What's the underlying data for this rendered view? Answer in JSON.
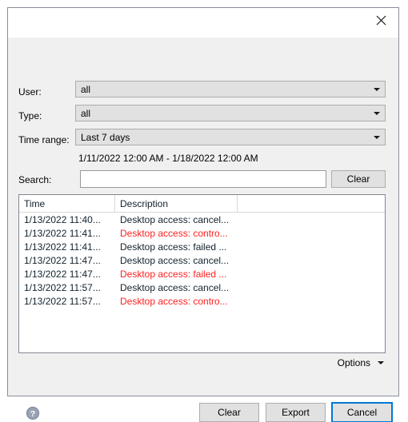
{
  "window": {
    "title": "",
    "close_icon": "close-icon"
  },
  "filters": {
    "user": {
      "label": "User:",
      "value": "all",
      "options": [
        "all"
      ]
    },
    "type": {
      "label": "Type:",
      "value": "all",
      "options": [
        "all"
      ]
    },
    "time_range": {
      "label": "Time range:",
      "value": "Last 7 days",
      "options": [
        "Last 7 days"
      ]
    },
    "date_range_text": "1/11/2022 12:00 AM - 1/18/2022 12:00 AM"
  },
  "search": {
    "label": "Search:",
    "value": "",
    "placeholder": "",
    "clear_label": "Clear"
  },
  "table": {
    "columns": [
      "Time",
      "Description",
      ""
    ],
    "sort_column": "Time",
    "sort_icon": "chevron-down-icon",
    "rows": [
      {
        "time": "1/13/2022 11:40...",
        "description": "Desktop access: cancel...",
        "extra": "",
        "severity": "normal"
      },
      {
        "time": "1/13/2022 11:41...",
        "description": "Desktop access: contro...",
        "extra": "",
        "severity": "alert"
      },
      {
        "time": "1/13/2022 11:41...",
        "description": "Desktop access: failed ...",
        "extra": "",
        "severity": "normal"
      },
      {
        "time": "1/13/2022 11:47...",
        "description": "Desktop access: cancel...",
        "extra": "",
        "severity": "normal"
      },
      {
        "time": "1/13/2022 11:47...",
        "description": "Desktop access: failed ...",
        "extra": "",
        "severity": "alert"
      },
      {
        "time": "1/13/2022 11:57...",
        "description": "Desktop access: cancel...",
        "extra": "",
        "severity": "normal"
      },
      {
        "time": "1/13/2022 11:57...",
        "description": "Desktop access: contro...",
        "extra": "",
        "severity": "alert"
      }
    ]
  },
  "options": {
    "label": "Options",
    "icon": "chevron-down-icon"
  },
  "footer": {
    "help_icon": "help-icon",
    "clear_label": "Clear",
    "export_label": "Export",
    "cancel_label": "Cancel",
    "focused_button": "Cancel"
  },
  "colors": {
    "alert_text": "#ff2020",
    "focus_ring": "#0078d7",
    "dialog_background": "#f0f0f0",
    "field_background": "#e1e1e1",
    "text": "#12222e"
  }
}
